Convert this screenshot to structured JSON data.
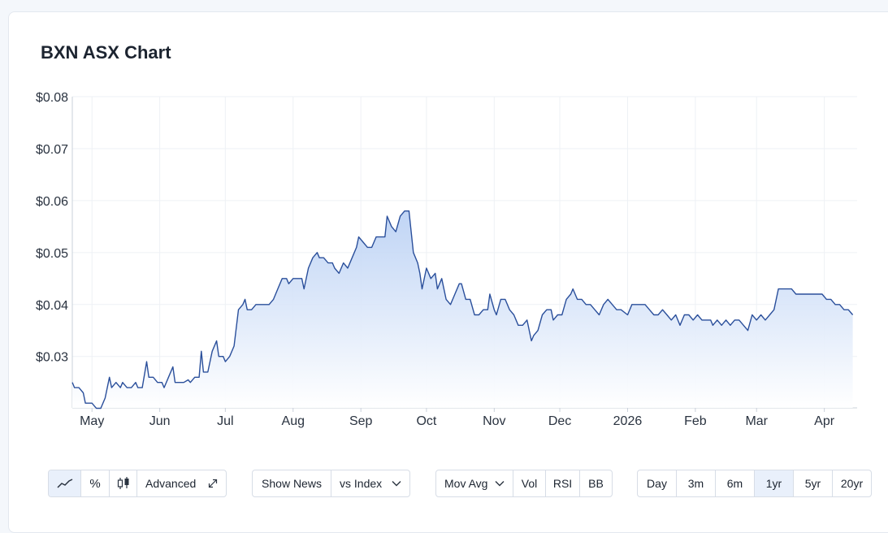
{
  "title": "BXN ASX Chart",
  "colors": {
    "line": "#2a4f9b",
    "fill_top": "#b9d0f4",
    "fill_bottom": "#ffffff",
    "grid": "#eef1f5",
    "active": "#e9f0fb"
  },
  "chart_data": {
    "type": "area",
    "title": "BXN ASX Chart",
    "y_ticks": [
      {
        "value": 0.08,
        "label": "$0.08"
      },
      {
        "value": 0.07,
        "label": "$0.07"
      },
      {
        "value": 0.06,
        "label": "$0.06"
      },
      {
        "value": 0.05,
        "label": "$0.05"
      },
      {
        "value": 0.04,
        "label": "$0.04"
      },
      {
        "value": 0.03,
        "label": "$0.03"
      }
    ],
    "ylim": [
      0.0201,
      0.08
    ],
    "x_range": [
      "2025-04-22",
      "2026-04-16"
    ],
    "x_ticks": [
      {
        "date": "2025-05-01",
        "label": "May"
      },
      {
        "date": "2025-06-01",
        "label": "Jun"
      },
      {
        "date": "2025-07-01",
        "label": "Jul"
      },
      {
        "date": "2025-08-01",
        "label": "Aug"
      },
      {
        "date": "2025-09-01",
        "label": "Sep"
      },
      {
        "date": "2025-10-01",
        "label": "Oct"
      },
      {
        "date": "2025-11-01",
        "label": "Nov"
      },
      {
        "date": "2025-12-01",
        "label": "Dec"
      },
      {
        "date": "2026-01-01",
        "label": "2026"
      },
      {
        "date": "2026-02-01",
        "label": "Feb"
      },
      {
        "date": "2026-03-01",
        "label": "Mar"
      },
      {
        "date": "2026-04-01",
        "label": "Apr"
      }
    ],
    "grid": true,
    "series": [
      {
        "points": [
          [
            "2025-04-22",
            0.025
          ],
          [
            "2025-04-23",
            0.024
          ],
          [
            "2025-04-25",
            0.024
          ],
          [
            "2025-04-27",
            0.023
          ],
          [
            "2025-04-28",
            0.021
          ],
          [
            "2025-05-01",
            0.021
          ],
          [
            "2025-05-03",
            0.02
          ],
          [
            "2025-05-05",
            0.02
          ],
          [
            "2025-05-07",
            0.022
          ],
          [
            "2025-05-09",
            0.026
          ],
          [
            "2025-05-10",
            0.024
          ],
          [
            "2025-05-12",
            0.025
          ],
          [
            "2025-05-14",
            0.024
          ],
          [
            "2025-05-15",
            0.025
          ],
          [
            "2025-05-17",
            0.024
          ],
          [
            "2025-05-19",
            0.024
          ],
          [
            "2025-05-21",
            0.025
          ],
          [
            "2025-05-22",
            0.024
          ],
          [
            "2025-05-24",
            0.024
          ],
          [
            "2025-05-26",
            0.029
          ],
          [
            "2025-05-27",
            0.026
          ],
          [
            "2025-05-29",
            0.026
          ],
          [
            "2025-05-31",
            0.025
          ],
          [
            "2025-06-02",
            0.025
          ],
          [
            "2025-06-03",
            0.024
          ],
          [
            "2025-06-05",
            0.026
          ],
          [
            "2025-06-07",
            0.028
          ],
          [
            "2025-06-08",
            0.025
          ],
          [
            "2025-06-10",
            0.025
          ],
          [
            "2025-06-12",
            0.025
          ],
          [
            "2025-06-14",
            0.0255
          ],
          [
            "2025-06-15",
            0.025
          ],
          [
            "2025-06-17",
            0.026
          ],
          [
            "2025-06-19",
            0.026
          ],
          [
            "2025-06-20",
            0.031
          ],
          [
            "2025-06-21",
            0.027
          ],
          [
            "2025-06-23",
            0.027
          ],
          [
            "2025-06-25",
            0.031
          ],
          [
            "2025-06-27",
            0.033
          ],
          [
            "2025-06-28",
            0.03
          ],
          [
            "2025-06-30",
            0.03
          ],
          [
            "2025-07-01",
            0.029
          ],
          [
            "2025-07-03",
            0.03
          ],
          [
            "2025-07-05",
            0.032
          ],
          [
            "2025-07-07",
            0.039
          ],
          [
            "2025-07-09",
            0.04
          ],
          [
            "2025-07-10",
            0.041
          ],
          [
            "2025-07-11",
            0.039
          ],
          [
            "2025-07-13",
            0.039
          ],
          [
            "2025-07-15",
            0.04
          ],
          [
            "2025-07-17",
            0.04
          ],
          [
            "2025-07-19",
            0.04
          ],
          [
            "2025-07-21",
            0.04
          ],
          [
            "2025-07-23",
            0.041
          ],
          [
            "2025-07-25",
            0.043
          ],
          [
            "2025-07-27",
            0.045
          ],
          [
            "2025-07-29",
            0.045
          ],
          [
            "2025-07-30",
            0.044
          ],
          [
            "2025-08-01",
            0.045
          ],
          [
            "2025-08-03",
            0.045
          ],
          [
            "2025-08-05",
            0.045
          ],
          [
            "2025-08-06",
            0.043
          ],
          [
            "2025-08-08",
            0.047
          ],
          [
            "2025-08-10",
            0.049
          ],
          [
            "2025-08-12",
            0.05
          ],
          [
            "2025-08-13",
            0.049
          ],
          [
            "2025-08-15",
            0.049
          ],
          [
            "2025-08-17",
            0.048
          ],
          [
            "2025-08-19",
            0.048
          ],
          [
            "2025-08-20",
            0.047
          ],
          [
            "2025-08-22",
            0.046
          ],
          [
            "2025-08-24",
            0.048
          ],
          [
            "2025-08-26",
            0.047
          ],
          [
            "2025-08-28",
            0.049
          ],
          [
            "2025-08-30",
            0.051
          ],
          [
            "2025-08-31",
            0.053
          ],
          [
            "2025-09-02",
            0.052
          ],
          [
            "2025-09-04",
            0.051
          ],
          [
            "2025-09-06",
            0.051
          ],
          [
            "2025-09-08",
            0.053
          ],
          [
            "2025-09-10",
            0.053
          ],
          [
            "2025-09-12",
            0.053
          ],
          [
            "2025-09-13",
            0.057
          ],
          [
            "2025-09-15",
            0.055
          ],
          [
            "2025-09-17",
            0.054
          ],
          [
            "2025-09-19",
            0.057
          ],
          [
            "2025-09-21",
            0.058
          ],
          [
            "2025-09-23",
            0.058
          ],
          [
            "2025-09-25",
            0.05
          ],
          [
            "2025-09-27",
            0.048
          ],
          [
            "2025-09-28",
            0.046
          ],
          [
            "2025-09-29",
            0.043
          ],
          [
            "2025-10-01",
            0.047
          ],
          [
            "2025-10-03",
            0.045
          ],
          [
            "2025-10-05",
            0.046
          ],
          [
            "2025-10-06",
            0.043
          ],
          [
            "2025-10-08",
            0.045
          ],
          [
            "2025-10-10",
            0.041
          ],
          [
            "2025-10-12",
            0.04
          ],
          [
            "2025-10-14",
            0.042
          ],
          [
            "2025-10-16",
            0.044
          ],
          [
            "2025-10-17",
            0.044
          ],
          [
            "2025-10-19",
            0.041
          ],
          [
            "2025-10-21",
            0.041
          ],
          [
            "2025-10-23",
            0.038
          ],
          [
            "2025-10-25",
            0.038
          ],
          [
            "2025-10-27",
            0.039
          ],
          [
            "2025-10-29",
            0.039
          ],
          [
            "2025-10-30",
            0.042
          ],
          [
            "2025-11-01",
            0.039
          ],
          [
            "2025-11-02",
            0.038
          ],
          [
            "2025-11-04",
            0.041
          ],
          [
            "2025-11-06",
            0.041
          ],
          [
            "2025-11-08",
            0.039
          ],
          [
            "2025-11-10",
            0.038
          ],
          [
            "2025-11-12",
            0.036
          ],
          [
            "2025-11-14",
            0.036
          ],
          [
            "2025-11-16",
            0.037
          ],
          [
            "2025-11-18",
            0.033
          ],
          [
            "2025-11-19",
            0.034
          ],
          [
            "2025-11-21",
            0.035
          ],
          [
            "2025-11-23",
            0.038
          ],
          [
            "2025-11-25",
            0.039
          ],
          [
            "2025-11-27",
            0.039
          ],
          [
            "2025-11-28",
            0.037
          ],
          [
            "2025-11-30",
            0.038
          ],
          [
            "2025-12-02",
            0.038
          ],
          [
            "2025-12-04",
            0.041
          ],
          [
            "2025-12-06",
            0.042
          ],
          [
            "2025-12-07",
            0.043
          ],
          [
            "2025-12-09",
            0.041
          ],
          [
            "2025-12-11",
            0.041
          ],
          [
            "2025-12-13",
            0.04
          ],
          [
            "2025-12-15",
            0.04
          ],
          [
            "2025-12-17",
            0.039
          ],
          [
            "2025-12-19",
            0.038
          ],
          [
            "2025-12-21",
            0.04
          ],
          [
            "2025-12-23",
            0.041
          ],
          [
            "2025-12-25",
            0.04
          ],
          [
            "2025-12-27",
            0.039
          ],
          [
            "2025-12-29",
            0.039
          ],
          [
            "2026-01-01",
            0.038
          ],
          [
            "2026-01-03",
            0.04
          ],
          [
            "2026-01-05",
            0.04
          ],
          [
            "2026-01-07",
            0.04
          ],
          [
            "2026-01-09",
            0.04
          ],
          [
            "2026-01-11",
            0.039
          ],
          [
            "2026-01-13",
            0.038
          ],
          [
            "2026-01-15",
            0.038
          ],
          [
            "2026-01-17",
            0.039
          ],
          [
            "2026-01-19",
            0.038
          ],
          [
            "2026-01-21",
            0.037
          ],
          [
            "2026-01-23",
            0.038
          ],
          [
            "2026-01-25",
            0.036
          ],
          [
            "2026-01-27",
            0.038
          ],
          [
            "2026-01-29",
            0.038
          ],
          [
            "2026-01-31",
            0.037
          ],
          [
            "2026-02-02",
            0.038
          ],
          [
            "2026-02-04",
            0.037
          ],
          [
            "2026-02-06",
            0.037
          ],
          [
            "2026-02-08",
            0.037
          ],
          [
            "2026-02-09",
            0.036
          ],
          [
            "2026-02-11",
            0.037
          ],
          [
            "2026-02-13",
            0.036
          ],
          [
            "2026-02-15",
            0.037
          ],
          [
            "2026-02-17",
            0.036
          ],
          [
            "2026-02-19",
            0.037
          ],
          [
            "2026-02-21",
            0.037
          ],
          [
            "2026-02-23",
            0.036
          ],
          [
            "2026-02-25",
            0.035
          ],
          [
            "2026-02-27",
            0.038
          ],
          [
            "2026-03-01",
            0.037
          ],
          [
            "2026-03-03",
            0.038
          ],
          [
            "2026-03-05",
            0.037
          ],
          [
            "2026-03-07",
            0.038
          ],
          [
            "2026-03-09",
            0.039
          ],
          [
            "2026-03-11",
            0.043
          ],
          [
            "2026-03-13",
            0.043
          ],
          [
            "2026-03-15",
            0.043
          ],
          [
            "2026-03-17",
            0.043
          ],
          [
            "2026-03-19",
            0.042
          ],
          [
            "2026-03-21",
            0.042
          ],
          [
            "2026-03-23",
            0.042
          ],
          [
            "2026-03-25",
            0.042
          ],
          [
            "2026-03-27",
            0.042
          ],
          [
            "2026-03-29",
            0.042
          ],
          [
            "2026-03-31",
            0.042
          ],
          [
            "2026-04-02",
            0.041
          ],
          [
            "2026-04-04",
            0.041
          ],
          [
            "2026-04-06",
            0.04
          ],
          [
            "2026-04-08",
            0.04
          ],
          [
            "2026-04-10",
            0.039
          ],
          [
            "2026-04-12",
            0.039
          ],
          [
            "2026-04-14",
            0.038
          ]
        ]
      }
    ]
  },
  "toolbar": {
    "chart_tools": {
      "line_icon": "line-chart-icon",
      "percent_label": "%",
      "candle_icon": "candlestick-icon",
      "advanced_label": "Advanced",
      "expand_icon": "expand-icon"
    },
    "news": {
      "show_news_label": "Show News",
      "vs_index_label": "vs Index",
      "chevron_icon": "chevron-down-icon"
    },
    "indicators": {
      "mov_avg_label": "Mov Avg",
      "chevron_icon": "chevron-down-icon",
      "vol_label": "Vol",
      "rsi_label": "RSI",
      "bb_label": "BB"
    },
    "periods": {
      "day": "Day",
      "m3": "3m",
      "m6": "6m",
      "y1": "1yr",
      "y5": "5yr",
      "y20": "20yr",
      "active": "1yr"
    }
  }
}
